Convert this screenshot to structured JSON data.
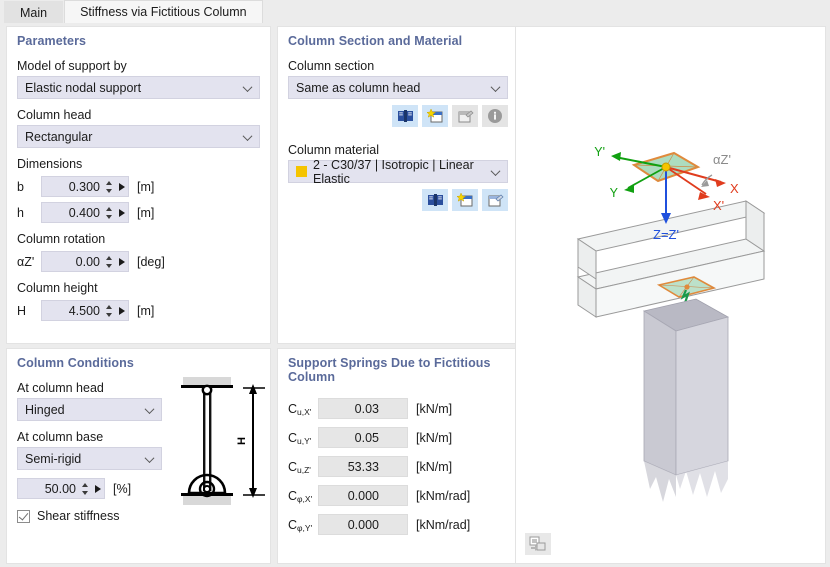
{
  "tabs": [
    {
      "label": "Main",
      "active": false
    },
    {
      "label": "Stiffness via Fictitious Column",
      "active": true
    }
  ],
  "parameters": {
    "title": "Parameters",
    "model_of_support_label": "Model of support by",
    "model_of_support_value": "Elastic nodal support",
    "column_head_label": "Column head",
    "column_head_value": "Rectangular",
    "dimensions_label": "Dimensions",
    "b_symbol": "b",
    "b_value": "0.300",
    "b_unit": "[m]",
    "h_symbol": "h",
    "h_value": "0.400",
    "h_unit": "[m]",
    "rotation_label": "Column rotation",
    "rotation_symbol": "αZ'",
    "rotation_value": "0.00",
    "rotation_unit": "[deg]",
    "height_label": "Column height",
    "height_symbol": "H",
    "height_value": "4.500",
    "height_unit": "[m]"
  },
  "conditions": {
    "title": "Column Conditions",
    "head_label": "At column head",
    "head_value": "Hinged",
    "base_label": "At column base",
    "base_value": "Semi-rigid",
    "base_percent": "50.00",
    "percent_unit": "[%]",
    "shear_stiffness_label": "Shear stiffness",
    "diagram_h_label": "H"
  },
  "section": {
    "title": "Column Section and Material",
    "section_label": "Column section",
    "section_value": "Same as column head",
    "material_label": "Column material",
    "material_value": "2 - C30/37 | Isotropic | Linear Elastic",
    "material_color": "#f5c400",
    "section_buttons": [
      {
        "icon": "library-book-icon",
        "disabled": false
      },
      {
        "icon": "new-item-icon",
        "disabled": false
      },
      {
        "icon": "edit-item-icon",
        "disabled": true
      },
      {
        "icon": "info-icon",
        "disabled": true
      }
    ],
    "material_buttons": [
      {
        "icon": "library-book-icon",
        "disabled": false
      },
      {
        "icon": "new-item-icon",
        "disabled": false
      },
      {
        "icon": "edit-item-icon",
        "disabled": false
      }
    ]
  },
  "springs": {
    "title": "Support Springs Due to Fictitious Column",
    "rows": [
      {
        "symbol_base": "C",
        "symbol_sub": "u,X'",
        "value": "0.03",
        "unit": "[kN/m]"
      },
      {
        "symbol_base": "C",
        "symbol_sub": "u,Y'",
        "value": "0.05",
        "unit": "[kN/m]"
      },
      {
        "symbol_base": "C",
        "symbol_sub": "u,Z'",
        "value": "53.33",
        "unit": "[kN/m]"
      },
      {
        "symbol_base": "C",
        "symbol_sub": "φ,X'",
        "value": "0.000",
        "unit": "[kNm/rad]"
      },
      {
        "symbol_base": "C",
        "symbol_sub": "φ,Y'",
        "value": "0.000",
        "unit": "[kNm/rad]"
      }
    ]
  },
  "viewport": {
    "axis_labels": {
      "y_prime": "Y'",
      "y": "Y",
      "x": "X",
      "x_prime": "X'",
      "z": "Z=Z'",
      "alpha": "αZ'"
    },
    "colors": {
      "x_axis": "#e03c1e",
      "y_axis": "#11a011",
      "z_axis": "#2050dd",
      "plane_fill": "#9fd6b4",
      "plane_edge": "#e08a3c",
      "node": "#f5c400",
      "solid": "#c8c8d0"
    }
  }
}
